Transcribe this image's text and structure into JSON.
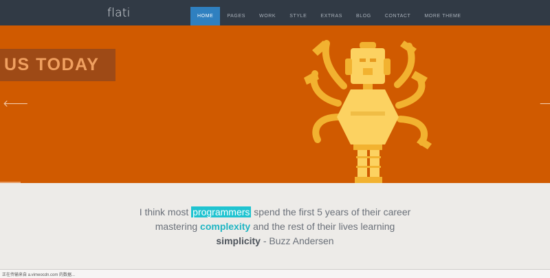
{
  "brand": {
    "logo": "flati"
  },
  "nav": {
    "items": [
      {
        "label": "HOME",
        "active": true
      },
      {
        "label": "PAGES",
        "active": false
      },
      {
        "label": "WORK",
        "active": false
      },
      {
        "label": "STYLE",
        "active": false
      },
      {
        "label": "EXTRAS",
        "active": false
      },
      {
        "label": "BLOG",
        "active": false
      },
      {
        "label": "CONTACT",
        "active": false
      },
      {
        "label": "MORE THEME",
        "active": false
      }
    ]
  },
  "hero": {
    "caption": "US TODAY",
    "prev_arrow": "🡐",
    "next_arrow": "🡒",
    "background_color": "#d05a00"
  },
  "quote": {
    "part1": "I think most ",
    "highlight1": "programmers",
    "part2": " spend the first 5 years of their career",
    "part3": "mastering ",
    "highlight2": "complexity",
    "part4": " and the rest of their lives learning",
    "highlight3": "simplicity",
    "author": " - Buzz Andersen"
  },
  "status": {
    "text": "正在传输来自 a.vimeocdn.com 的数据..."
  },
  "colors": {
    "nav_bg": "#313a45",
    "nav_active": "#2f80c0",
    "accent": "#1fc3d0"
  }
}
